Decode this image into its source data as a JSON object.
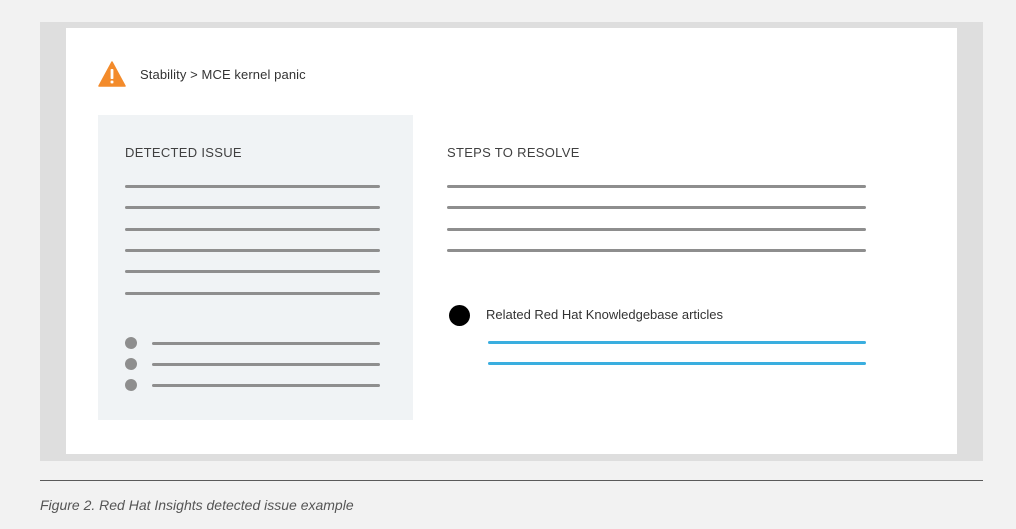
{
  "breadcrumb": {
    "icon": "warning-triangle-icon",
    "icon_color": "#f38b2b",
    "text": "Stability > MCE kernel panic"
  },
  "detected_issue": {
    "title": "DETECTED ISSUE"
  },
  "steps_to_resolve": {
    "title": "STEPS TO RESOLVE",
    "related_label": "Related Red Hat Knowledgebase articles",
    "link_color": "#3aaedf"
  },
  "caption": "Figure 2. Red Hat Insights detected issue example"
}
